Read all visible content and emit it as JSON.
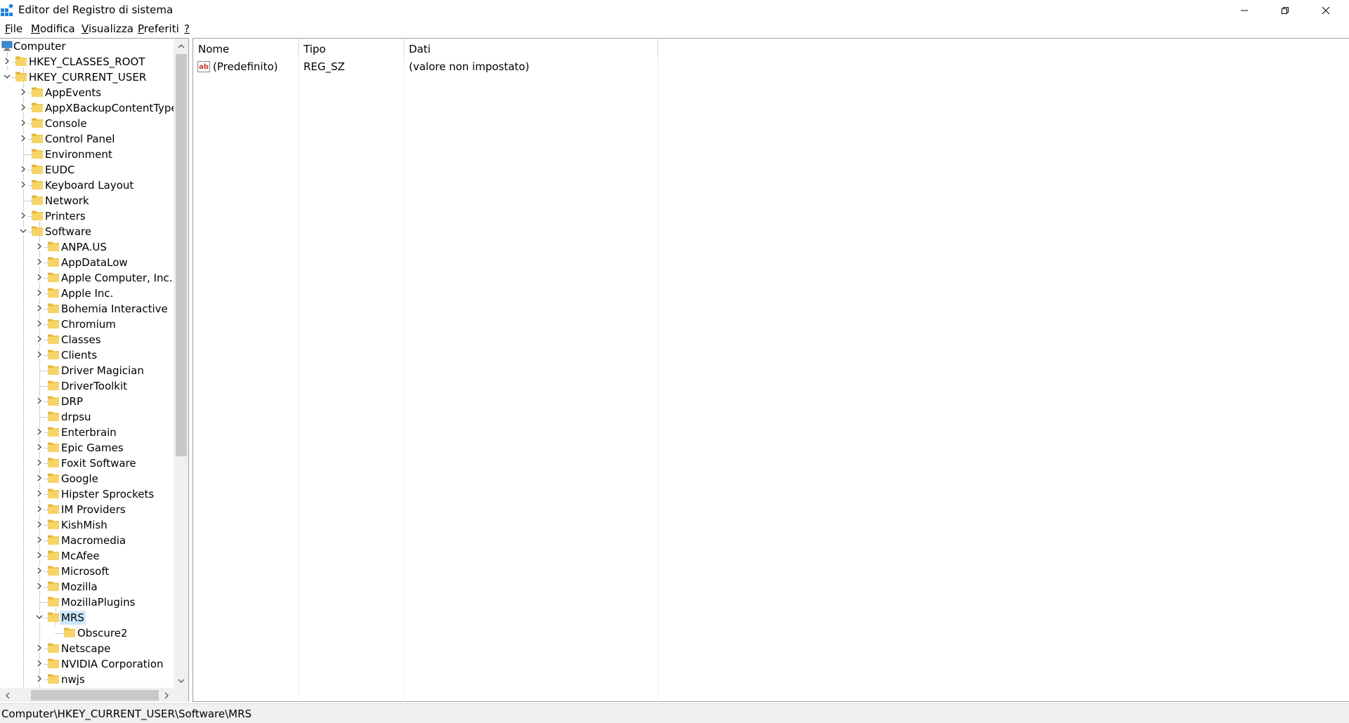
{
  "window": {
    "title": "Editor del Registro di sistema"
  },
  "menu": [
    {
      "label": "File",
      "key": "F",
      "rest": "ile"
    },
    {
      "label": "Modifica",
      "key": "M",
      "rest": "odifica"
    },
    {
      "label": "Visualizza",
      "key": "V",
      "rest": "isualizza"
    },
    {
      "label": "Preferiti",
      "key": "P",
      "rest": "referiti"
    },
    {
      "label": "?",
      "key": "?",
      "rest": ""
    }
  ],
  "tree": [
    {
      "label": "Computer",
      "level": 0,
      "toggle": "none",
      "icon": "computer-icon"
    },
    {
      "label": "HKEY_CLASSES_ROOT",
      "level": 1,
      "toggle": "collapsed"
    },
    {
      "label": "HKEY_CURRENT_USER",
      "level": 1,
      "toggle": "expanded"
    },
    {
      "label": "AppEvents",
      "level": 2,
      "toggle": "collapsed"
    },
    {
      "label": "AppXBackupContentType",
      "level": 2,
      "toggle": "collapsed"
    },
    {
      "label": "Console",
      "level": 2,
      "toggle": "collapsed"
    },
    {
      "label": "Control Panel",
      "level": 2,
      "toggle": "collapsed"
    },
    {
      "label": "Environment",
      "level": 2,
      "toggle": "none"
    },
    {
      "label": "EUDC",
      "level": 2,
      "toggle": "collapsed"
    },
    {
      "label": "Keyboard Layout",
      "level": 2,
      "toggle": "collapsed"
    },
    {
      "label": "Network",
      "level": 2,
      "toggle": "none"
    },
    {
      "label": "Printers",
      "level": 2,
      "toggle": "collapsed"
    },
    {
      "label": "Software",
      "level": 2,
      "toggle": "expanded"
    },
    {
      "label": "ANPA.US",
      "level": 3,
      "toggle": "collapsed"
    },
    {
      "label": "AppDataLow",
      "level": 3,
      "toggle": "collapsed"
    },
    {
      "label": "Apple Computer, Inc.",
      "level": 3,
      "toggle": "collapsed"
    },
    {
      "label": "Apple Inc.",
      "level": 3,
      "toggle": "collapsed"
    },
    {
      "label": "Bohemia Interactive",
      "level": 3,
      "toggle": "collapsed"
    },
    {
      "label": "Chromium",
      "level": 3,
      "toggle": "collapsed"
    },
    {
      "label": "Classes",
      "level": 3,
      "toggle": "collapsed"
    },
    {
      "label": "Clients",
      "level": 3,
      "toggle": "collapsed"
    },
    {
      "label": "Driver Magician",
      "level": 3,
      "toggle": "none"
    },
    {
      "label": "DriverToolkit",
      "level": 3,
      "toggle": "none"
    },
    {
      "label": "DRP",
      "level": 3,
      "toggle": "collapsed"
    },
    {
      "label": "drpsu",
      "level": 3,
      "toggle": "none"
    },
    {
      "label": "Enterbrain",
      "level": 3,
      "toggle": "collapsed"
    },
    {
      "label": "Epic Games",
      "level": 3,
      "toggle": "collapsed"
    },
    {
      "label": "Foxit Software",
      "level": 3,
      "toggle": "collapsed"
    },
    {
      "label": "Google",
      "level": 3,
      "toggle": "collapsed"
    },
    {
      "label": "Hipster Sprockets",
      "level": 3,
      "toggle": "collapsed"
    },
    {
      "label": "IM Providers",
      "level": 3,
      "toggle": "collapsed"
    },
    {
      "label": "KishMish",
      "level": 3,
      "toggle": "collapsed"
    },
    {
      "label": "Macromedia",
      "level": 3,
      "toggle": "collapsed"
    },
    {
      "label": "McAfee",
      "level": 3,
      "toggle": "collapsed"
    },
    {
      "label": "Microsoft",
      "level": 3,
      "toggle": "collapsed"
    },
    {
      "label": "Mozilla",
      "level": 3,
      "toggle": "collapsed"
    },
    {
      "label": "MozillaPlugins",
      "level": 3,
      "toggle": "none"
    },
    {
      "label": "MRS",
      "level": 3,
      "toggle": "expanded",
      "selected": true
    },
    {
      "label": "Obscure2",
      "level": 4,
      "toggle": "none"
    },
    {
      "label": "Netscape",
      "level": 3,
      "toggle": "collapsed"
    },
    {
      "label": "NVIDIA Corporation",
      "level": 3,
      "toggle": "collapsed"
    },
    {
      "label": "nwjs",
      "level": 3,
      "toggle": "collapsed"
    }
  ],
  "list": {
    "columns": [
      "Nome",
      "Tipo",
      "Dati"
    ],
    "rows": [
      {
        "name": "(Predefinito)",
        "type": "REG_SZ",
        "data": "(valore non impostato)",
        "icon": "string-value-icon"
      }
    ]
  },
  "status": {
    "path": "Computer\\HKEY_CURRENT_USER\\Software\\MRS"
  },
  "colors": {
    "selection": "#cce8ff",
    "folder": "#f3c94f",
    "scrollbar_thumb": "#c8c8c8"
  }
}
